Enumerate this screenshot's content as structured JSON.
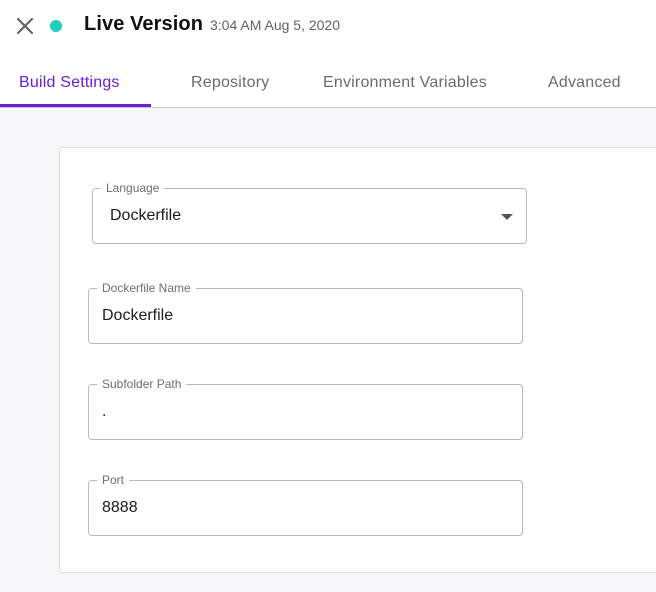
{
  "header": {
    "title": "Live Version",
    "timestamp": "3:04 AM Aug 5, 2020",
    "close_icon": "close-icon",
    "status_color": "#1fcfbf"
  },
  "tabs": [
    {
      "label": "Build Settings",
      "active": true
    },
    {
      "label": "Repository",
      "active": false
    },
    {
      "label": "Environment Variables",
      "active": false
    },
    {
      "label": "Advanced",
      "active": false
    }
  ],
  "accent_color": "#6b1fd1",
  "form": {
    "language": {
      "label": "Language",
      "value": "Dockerfile"
    },
    "dockerfile_name": {
      "label": "Dockerfile Name",
      "value": "Dockerfile"
    },
    "subfolder_path": {
      "label": "Subfolder Path",
      "value": "."
    },
    "port": {
      "label": "Port",
      "value": "8888"
    }
  }
}
